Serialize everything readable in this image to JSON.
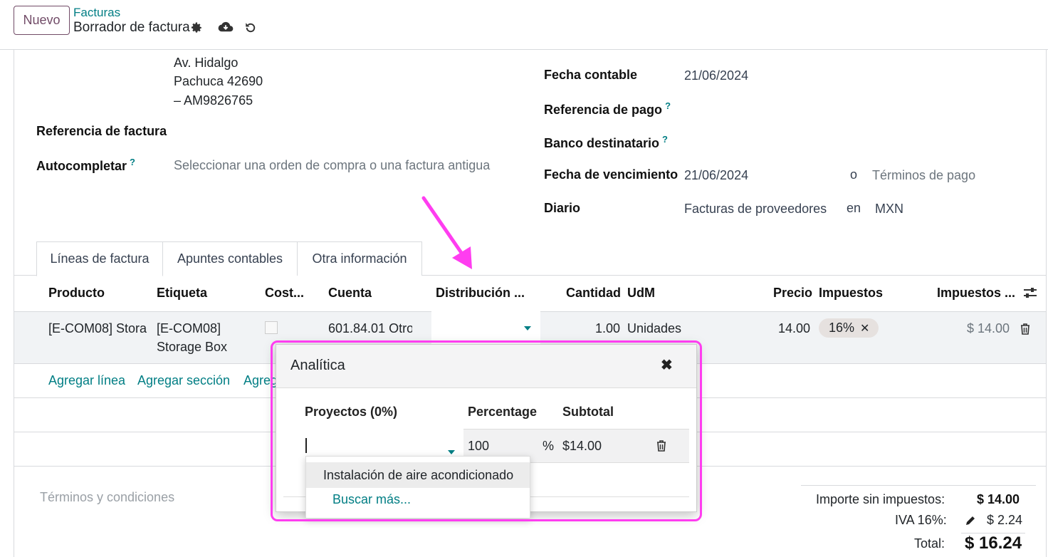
{
  "header": {
    "new_label": "Nuevo",
    "breadcrumb": "Facturas",
    "title": "Borrador de factura"
  },
  "partner": {
    "address_line1": "Av. Hidalgo",
    "address_line2": "Pachuca 42690",
    "address_line3": "– AM9826765"
  },
  "left_fields": {
    "ref_label": "Referencia de factura",
    "autocomplete_label": "Autocompletar",
    "autocomplete_help": "?",
    "autocomplete_placeholder": "Seleccionar una orden de compra o una factura antigua"
  },
  "right_fields": {
    "accounting_date_label": "Fecha contable",
    "accounting_date_value": "21/06/2024",
    "payment_ref_label": "Referencia de pago",
    "payment_ref_help": "?",
    "bank_label": "Banco destinatario",
    "bank_help": "?",
    "due_date_label": "Fecha de vencimiento",
    "due_date_value": "21/06/2024",
    "or_label": "o",
    "payment_terms_placeholder": "Términos de pago",
    "journal_label": "Diario",
    "journal_value": "Facturas de proveedores",
    "in_label": "en",
    "currency_value": "MXN"
  },
  "tabs": [
    "Líneas de factura",
    "Apuntes contables",
    "Otra información"
  ],
  "columns": {
    "product": "Producto",
    "label": "Etiqueta",
    "cost": "Cost...",
    "account": "Cuenta",
    "distribution": "Distribución ...",
    "quantity": "Cantidad",
    "uom": "UdM",
    "price": "Precio",
    "taxes": "Impuestos",
    "tax_amount": "Impuestos ..."
  },
  "line": {
    "product": "[E-COM08] Stora",
    "label_line1": "[E-COM08]",
    "label_line2": "Storage Box",
    "account": "601.84.01 Otro",
    "quantity": "1.00",
    "uom": "Unidades",
    "price": "14.00",
    "tax_tag": "16%",
    "subtotal": "$ 14.00"
  },
  "add_links": {
    "add_line": "Agregar línea",
    "add_section": "Agregar sección",
    "add_note": "Agreg"
  },
  "terms_placeholder": "Términos y condiciones",
  "popup": {
    "title": "Analítica",
    "col_projects": "Proyectos (0%)",
    "col_percentage": "Percentage",
    "col_subtotal": "Subtotal",
    "percentage_value": "100",
    "percent_sign": "%",
    "subtotal_value": "$14.00",
    "dropdown_option": "Instalación de aire acondicionado",
    "dropdown_more": "Buscar más..."
  },
  "totals": {
    "untaxed_label": "Importe sin impuestos:",
    "untaxed_value": "$ 14.00",
    "tax_label": "IVA 16%:",
    "tax_value": "$ 2.24",
    "total_label": "Total:",
    "total_value": "$ 16.24"
  },
  "colors": {
    "primary": "#714b67",
    "link": "#017e84",
    "annotation": "#ff3df0"
  }
}
